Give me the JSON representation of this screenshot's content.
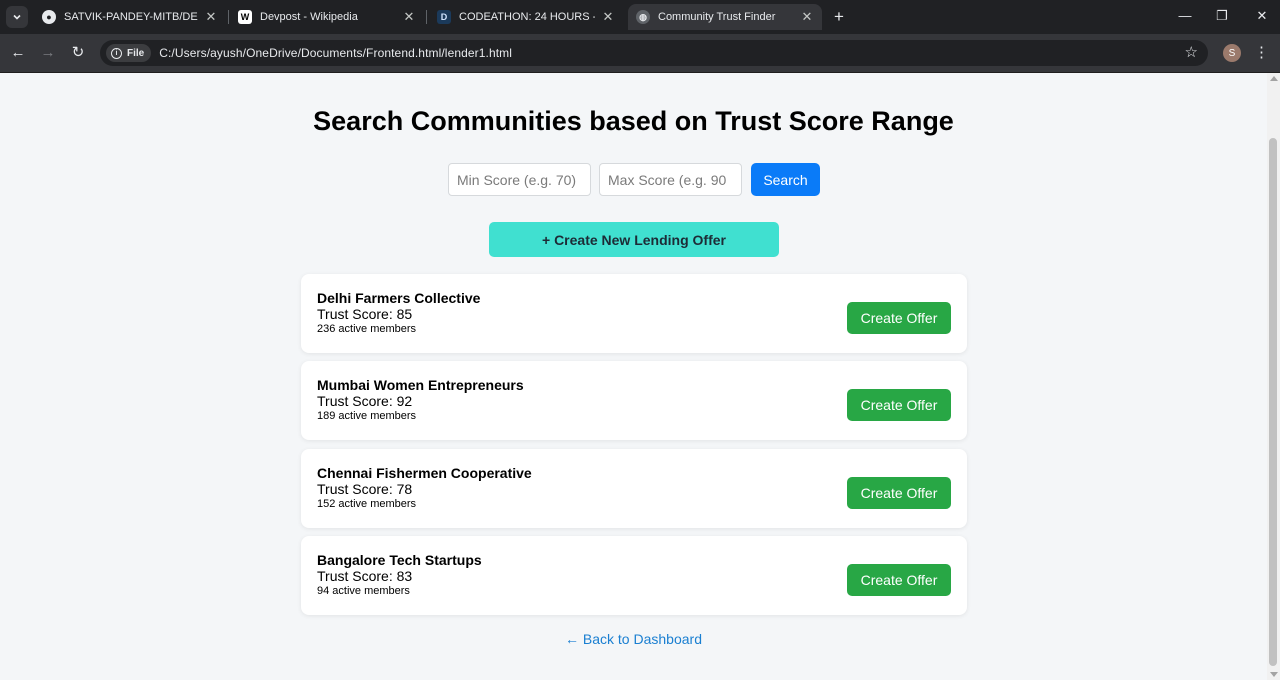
{
  "browser": {
    "tabs": [
      {
        "title": "SATVIK-PANDEY-MITB/DECENTRALIZED",
        "icon": "github-icon",
        "active": false
      },
      {
        "title": "Devpost - Wikipedia",
        "icon": "wikipedia-icon",
        "active": false
      },
      {
        "title": "CODEATHON: 24 HOURS - Devpost",
        "icon": "devpost-icon",
        "active": false
      },
      {
        "title": "Community Trust Finder",
        "icon": "globe-icon",
        "active": true
      }
    ],
    "address": {
      "scheme_chip": "File",
      "url": "C:/Users/ayush/OneDrive/Documents/Frontend.html/lender1.html"
    },
    "profile_initial": "S"
  },
  "page": {
    "title": "Search Communities based on Trust Score Range",
    "search": {
      "min_placeholder": "Min Score (e.g. 70)",
      "max_placeholder": "Max Score (e.g. 90",
      "button_label": "Search"
    },
    "create_new_label": "+ Create New Lending Offer",
    "score_prefix": "Trust Score: ",
    "offer_button_label": "Create Offer",
    "communities": [
      {
        "name": "Delhi Farmers Collective",
        "trust_score": 85,
        "members": "236 active members"
      },
      {
        "name": "Mumbai Women Entrepreneurs",
        "trust_score": 92,
        "members": "189 active members"
      },
      {
        "name": "Chennai Fishermen Cooperative",
        "trust_score": 78,
        "members": "152 active members"
      },
      {
        "name": "Bangalore Tech Startups",
        "trust_score": 83,
        "members": "94 active members"
      }
    ],
    "back_link": "← Back to Dashboard"
  },
  "colors": {
    "search_button": "#0a7bf8",
    "create_new_button": "#40e0d0",
    "offer_button": "#28a745",
    "link": "#1a7fd1"
  }
}
